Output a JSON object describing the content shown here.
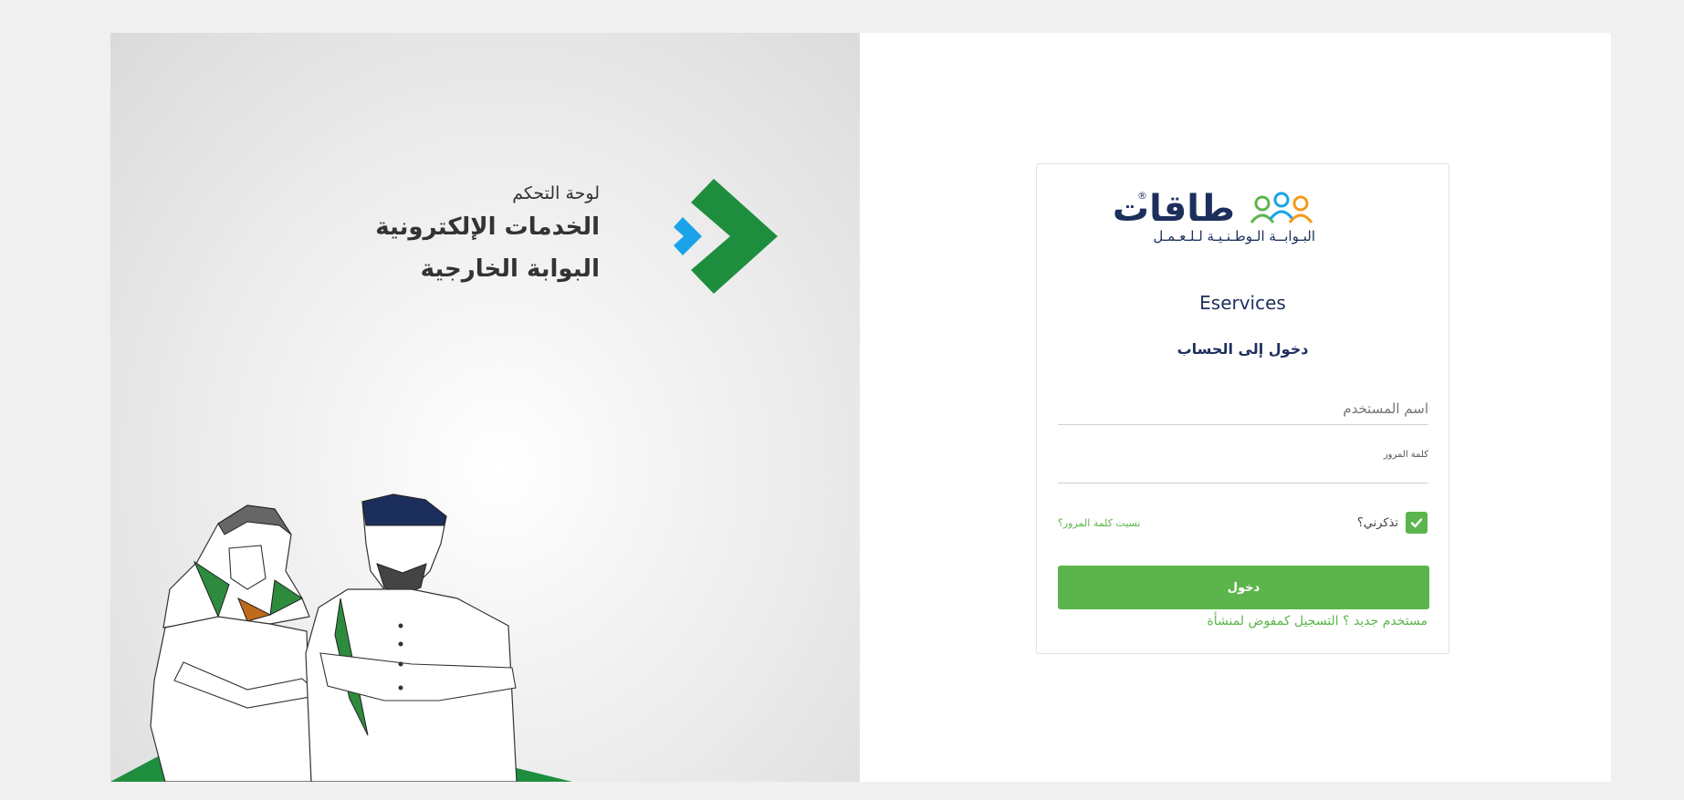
{
  "left_panel": {
    "subtitle": "لوحة التحكم",
    "line1": "الخدمات الإلكترونية",
    "line2": "البوابة الخارجية"
  },
  "logo": {
    "word": "طاقات",
    "registered": "®",
    "tagline": "البـوابــة الـوطـنـيـة لـلـعـمـل"
  },
  "login": {
    "app_title": "Eservices",
    "heading": "دخول إلى الحساب",
    "username_placeholder": "اسم المستخدم",
    "username_value": "",
    "password_label": "كلمة المرور",
    "password_value": "",
    "remember_label": "تذكرني؟",
    "remember_checked": true,
    "forgot_link": "نسيت كلمة المرور؟",
    "submit_label": "دخول",
    "register_link": "مستخدم جديد ؟ التسجيل كمفوض لمنشأة"
  },
  "colors": {
    "page_bg": "#f0f0f0",
    "accent_green": "#5cb54c",
    "brand_green": "#1e8e3e",
    "brand_blue": "#1aa3e8",
    "navy": "#1c2f5c"
  }
}
